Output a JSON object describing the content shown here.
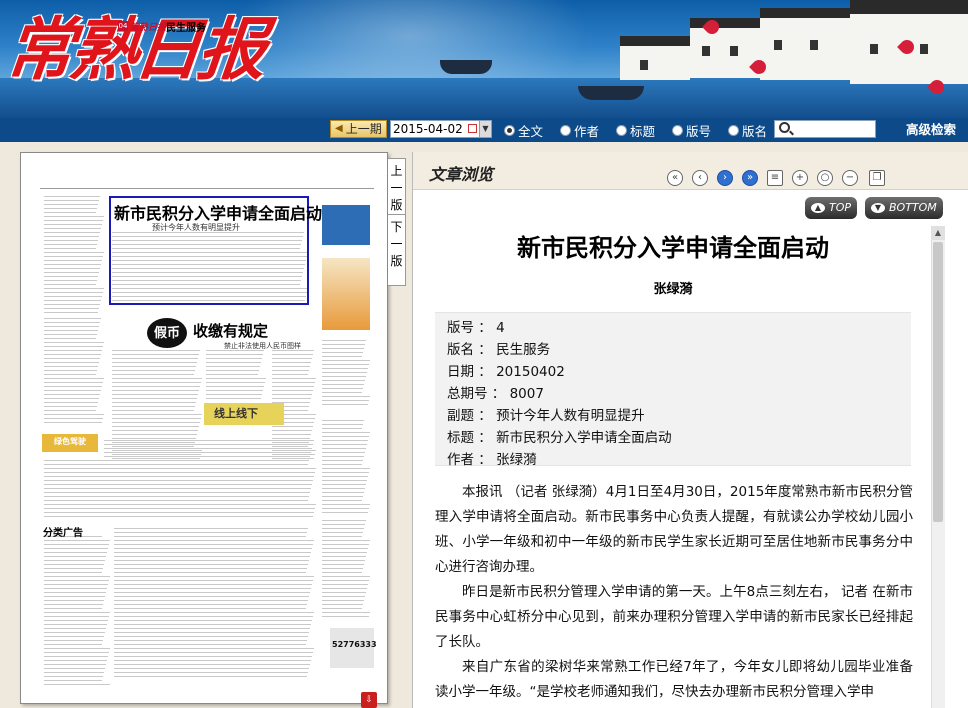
{
  "brand": {
    "logo_text": "常熟日报",
    "accent_color": "#e0141b",
    "toolbar_color": "#0d4a8a"
  },
  "toolbar": {
    "prev_issue_label": "上一期",
    "date_value": "2015-04-02",
    "search_options": [
      "全文",
      "作者",
      "标题",
      "版号",
      "版名"
    ],
    "selected_option": "全文",
    "search_placeholder": "",
    "advanced_search_label": "高级检索"
  },
  "page_nav": {
    "prev_page": "上一版",
    "next_page": "下一版"
  },
  "newspaper_page": {
    "page_number": "04",
    "paper_name": "常熟日报",
    "section_name": "民生服务",
    "headline": "新市民积分入学申请全面启动",
    "headline_sub": "预计今年人数有明显提升",
    "coin_label": "假币",
    "story2_title": "收缴有规定",
    "story2_sub": "禁止非法使用人民币图样",
    "banner_text": "线上线下",
    "ad_section_title": "分类广告",
    "yellow_ad_text": "绿色驾驶",
    "phone_number": "52776333"
  },
  "article_view": {
    "panel_title": "文章浏览",
    "top_button": "TOP",
    "bottom_button": "BOTTOM",
    "title": "新市民积分入学申请全面启动",
    "author": "张绿漪",
    "meta": [
      {
        "label": "版号",
        "value": "4"
      },
      {
        "label": "版名",
        "value": "民生服务"
      },
      {
        "label": "日期",
        "value": "20150402"
      },
      {
        "label": "总期号",
        "value": "8007"
      },
      {
        "label": "副题",
        "value": "预计今年人数有明显提升"
      },
      {
        "label": "标题",
        "value": "新市民积分入学申请全面启动"
      },
      {
        "label": "作者",
        "value": "张绿漪"
      }
    ],
    "paragraphs": [
      "本报讯 （记者 张绿漪）4月1日至4月30日，2015年度常熟市新市民积分管理入学申请将全面启动。新市民事务中心负责人提醒，有就读公办学校幼儿园小班、小学一年级和初中一年级的新市民学生家长近期可至居住地新市民事务分中心进行咨询办理。",
      "昨日是新市民积分管理入学申请的第一天。上午8点三刻左右， 记者 在新市民事务中心虹桥分中心见到，前来办理积分管理入学申请的新市民家长已经排起了长队。",
      "来自广东省的梁树华来常熟工作已经7年了，今年女儿即将幼儿园毕业准备读小学一年级。“是学校老师通知我们，尽快去办理新市民积分管理入学申"
    ]
  }
}
